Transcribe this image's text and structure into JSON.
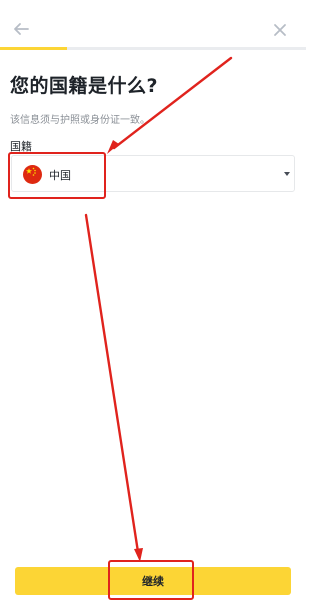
{
  "header": {
    "back_icon": "arrow-left-icon",
    "close_icon": "close-icon",
    "progress": 0.22
  },
  "page": {
    "title": "您的国籍是什么?",
    "subtitle": "该信息须与护照或身份证一致。"
  },
  "nationality": {
    "label": "国籍",
    "selected_value": "中国",
    "flag_icon": "china-flag-icon",
    "dropdown_icon": "caret-down-icon"
  },
  "footer": {
    "continue_label": "继续"
  },
  "colors": {
    "accent": "#fcd535",
    "annotation": "#e0231d",
    "text": "#1e2329",
    "muted": "#8a8f96"
  }
}
